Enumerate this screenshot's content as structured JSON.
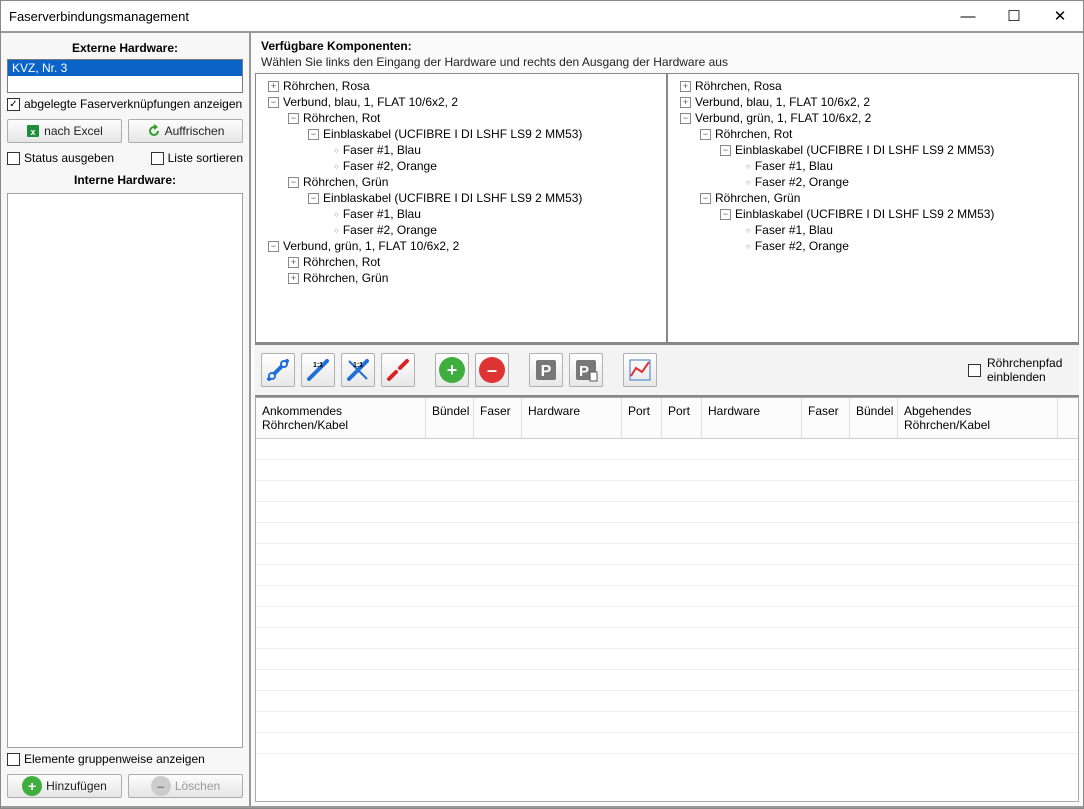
{
  "titlebar": {
    "title": "Faserverbindungsmanagement"
  },
  "left": {
    "externeTitle": "Externe Hardware:",
    "externeItems": [
      "KVZ, Nr. 3"
    ],
    "chkAbgelegte": "abgelegte Faserverknüpfungen anzeigen",
    "btnExcel": "nach Excel",
    "btnRefresh": "Auffrischen",
    "chkStatus": "Status ausgeben",
    "chkSort": "Liste sortieren",
    "interneTitle": "Interne Hardware:",
    "chkGruppen": "Elemente gruppenweise anzeigen",
    "btnAdd": "Hinzufügen",
    "btnDelete": "Löschen"
  },
  "right": {
    "header": "Verfügbare Komponenten:",
    "subheader": "Wählen Sie links den Eingang der Hardware und rechts den Ausgang der Hardware aus",
    "treeLeft": [
      {
        "ind": 1,
        "tog": "+",
        "label": "Röhrchen, Rosa"
      },
      {
        "ind": 1,
        "tog": "−",
        "label": "Verbund, blau, 1, FLAT 10/6x2, 2"
      },
      {
        "ind": 2,
        "tog": "−",
        "label": "Röhrchen, Rot"
      },
      {
        "ind": 3,
        "tog": "−",
        "label": "Einblaskabel (UCFIBRE I DI LSHF LS9 2 MM53)"
      },
      {
        "ind": 4,
        "leaf": true,
        "label": "Faser #1, Blau"
      },
      {
        "ind": 4,
        "leaf": true,
        "label": "Faser #2, Orange"
      },
      {
        "ind": 2,
        "tog": "−",
        "label": "Röhrchen, Grün"
      },
      {
        "ind": 3,
        "tog": "−",
        "label": "Einblaskabel (UCFIBRE I DI LSHF LS9 2 MM53)"
      },
      {
        "ind": 4,
        "leaf": true,
        "label": "Faser #1, Blau"
      },
      {
        "ind": 4,
        "leaf": true,
        "label": "Faser #2, Orange"
      },
      {
        "ind": 1,
        "tog": "−",
        "label": "Verbund, grün, 1, FLAT 10/6x2, 2"
      },
      {
        "ind": 2,
        "tog": "+",
        "label": "Röhrchen, Rot"
      },
      {
        "ind": 2,
        "tog": "+",
        "label": "Röhrchen, Grün"
      }
    ],
    "treeRight": [
      {
        "ind": 1,
        "tog": "+",
        "label": "Röhrchen, Rosa"
      },
      {
        "ind": 1,
        "tog": "+",
        "label": "Verbund, blau, 1, FLAT 10/6x2, 2"
      },
      {
        "ind": 1,
        "tog": "−",
        "label": "Verbund, grün, 1, FLAT 10/6x2, 2"
      },
      {
        "ind": 2,
        "tog": "−",
        "label": "Röhrchen, Rot"
      },
      {
        "ind": 3,
        "tog": "−",
        "label": "Einblaskabel (UCFIBRE I DI LSHF LS9 2 MM53)"
      },
      {
        "ind": 4,
        "leaf": true,
        "label": "Faser #1, Blau"
      },
      {
        "ind": 4,
        "leaf": true,
        "label": "Faser #2, Orange"
      },
      {
        "ind": 2,
        "tog": "−",
        "label": "Röhrchen, Grün"
      },
      {
        "ind": 3,
        "tog": "−",
        "label": "Einblaskabel (UCFIBRE I DI LSHF LS9 2 MM53)"
      },
      {
        "ind": 4,
        "leaf": true,
        "label": "Faser #1, Blau"
      },
      {
        "ind": 4,
        "leaf": true,
        "label": "Faser #2, Orange"
      }
    ],
    "toolbar": {
      "chkPfad": "Röhrchenpfad einblenden"
    },
    "gridHeaders": [
      "Ankommendes Röhrchen/Kabel",
      "Bündel",
      "Faser",
      "Hardware",
      "Port",
      "Port",
      "Hardware",
      "Faser",
      "Bündel",
      "Abgehendes Röhrchen/Kabel"
    ],
    "gridColWidths": [
      170,
      48,
      48,
      100,
      40,
      40,
      100,
      48,
      48,
      160
    ]
  }
}
